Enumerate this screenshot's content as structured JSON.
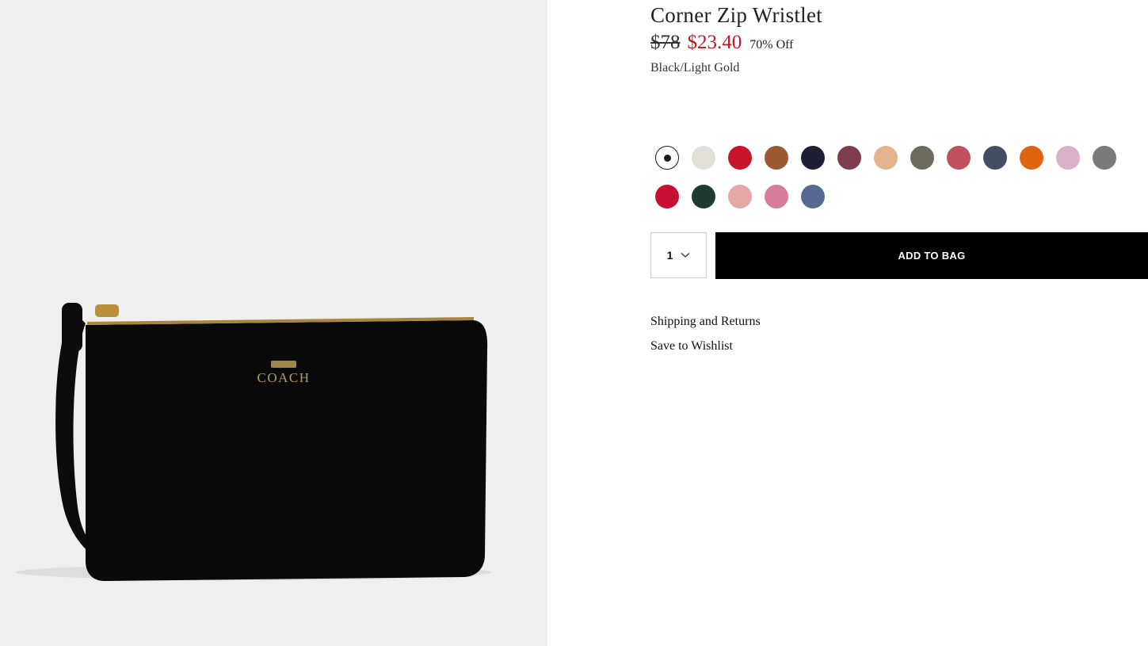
{
  "product": {
    "title": "Corner Zip Wristlet",
    "price_original": "$78",
    "price_sale": "$23.40",
    "discount": "70% Off",
    "color_name": "Black/Light Gold",
    "image_alt": "black-leather-wristlet-photo",
    "logo_text": "COACH"
  },
  "swatches": {
    "row1": [
      {
        "name": "Black/Light Gold",
        "hex": "#111111",
        "selected": true
      },
      {
        "name": "Chalk",
        "hex": "#e2dfd9"
      },
      {
        "name": "Red",
        "hex": "#c8142a"
      },
      {
        "name": "Saddle",
        "hex": "#9b5a34"
      },
      {
        "name": "Midnight",
        "hex": "#1d1f33"
      },
      {
        "name": "Wine",
        "hex": "#7d3d4a"
      },
      {
        "name": "Beechwood",
        "hex": "#e2b48d"
      },
      {
        "name": "Olive",
        "hex": "#6d6c5c"
      },
      {
        "name": "Rose",
        "hex": "#c0505f"
      },
      {
        "name": "Slate",
        "hex": "#424c63"
      },
      {
        "name": "Orange",
        "hex": "#e0640f"
      },
      {
        "name": "Lilac",
        "hex": "#dbb1c8"
      },
      {
        "name": "Grey",
        "hex": "#7b7a7a"
      }
    ],
    "row2": [
      {
        "name": "Cherry",
        "hex": "#c80f33"
      },
      {
        "name": "Forest",
        "hex": "#1f3a32"
      },
      {
        "name": "Blush",
        "hex": "#e6a7a9"
      },
      {
        "name": "Pink",
        "hex": "#d87c9b"
      },
      {
        "name": "Denim",
        "hex": "#566992"
      }
    ]
  },
  "cart": {
    "quantity": "1",
    "add_label": "ADD TO BAG"
  },
  "links": {
    "shipping": "Shipping and Returns",
    "wishlist": "Save to Wishlist"
  },
  "colors": {
    "sale_red": "#c4161c",
    "button_black": "#000000",
    "image_bg": "#efefef"
  }
}
